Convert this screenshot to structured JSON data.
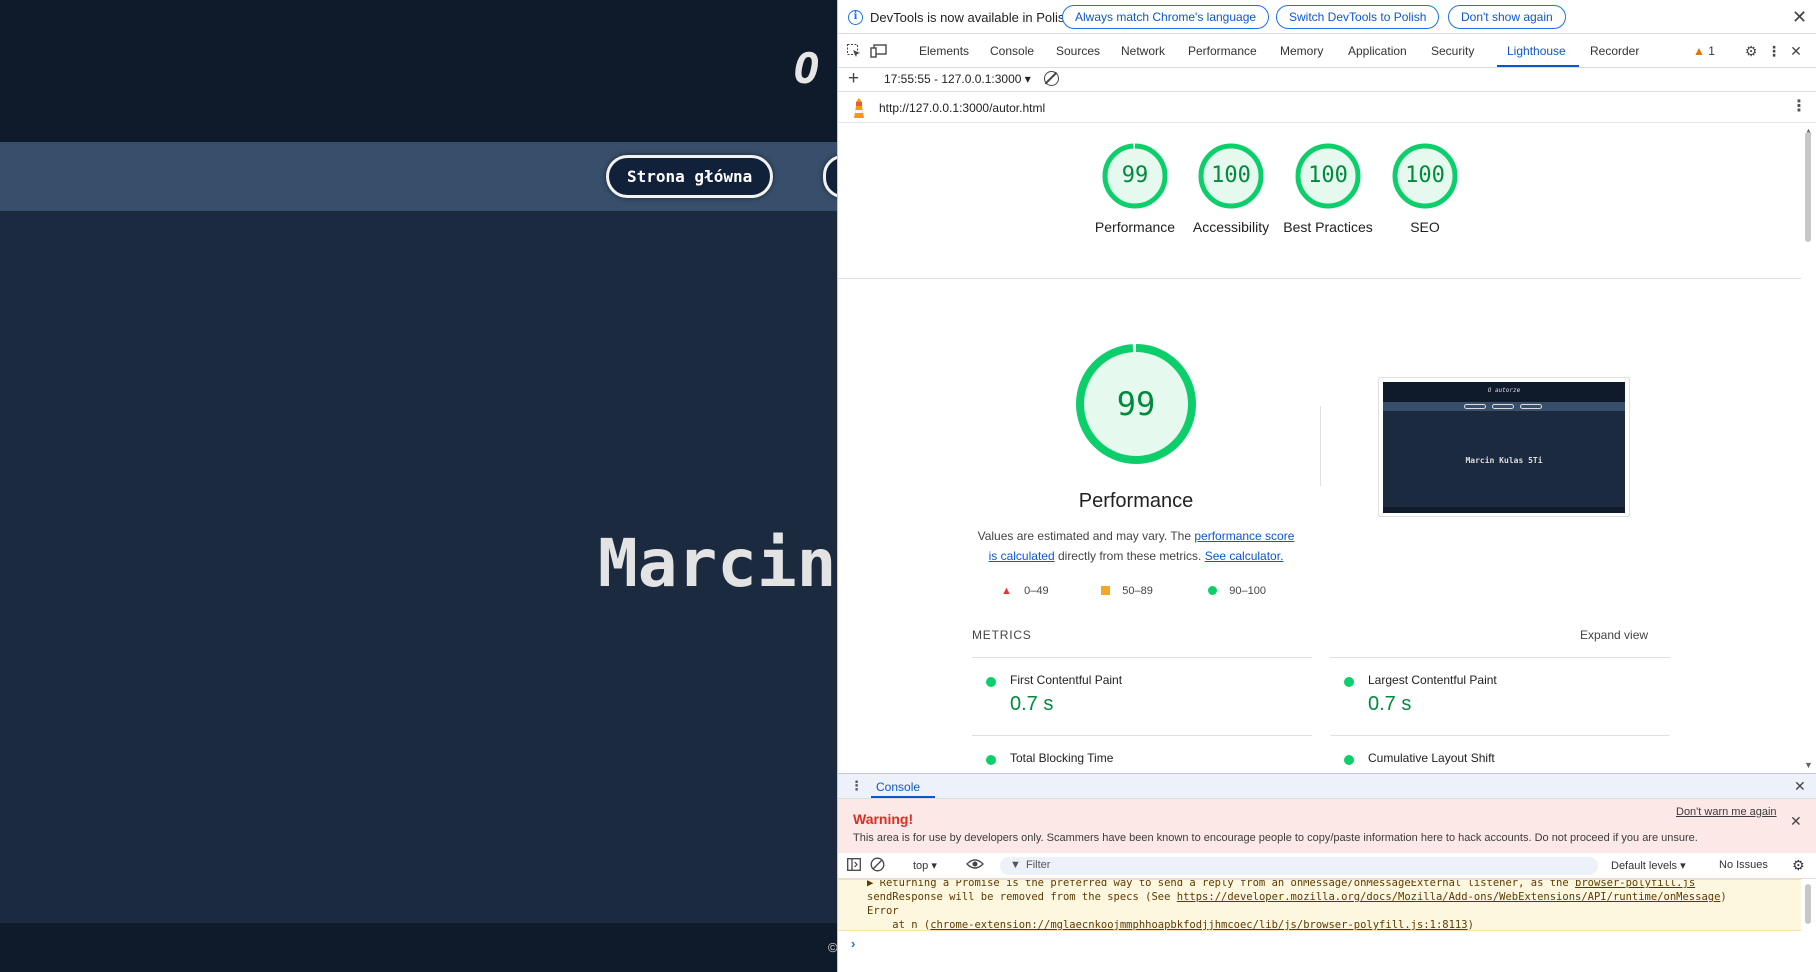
{
  "page": {
    "title": "O",
    "nav_home": "Strona główna",
    "main_text": "Marcin",
    "footer_text": "©"
  },
  "infobar": {
    "message": "DevTools is now available in Polish!",
    "btn_match": "Always match Chrome's language",
    "btn_switch": "Switch DevTools to Polish",
    "btn_dont_show": "Don't show again"
  },
  "tabs": [
    {
      "label": "Elements"
    },
    {
      "label": "Console"
    },
    {
      "label": "Sources"
    },
    {
      "label": "Network"
    },
    {
      "label": "Performance"
    },
    {
      "label": "Memory"
    },
    {
      "label": "Application"
    },
    {
      "label": "Security"
    },
    {
      "label": "Lighthouse",
      "active": true
    },
    {
      "label": "Recorder"
    }
  ],
  "issues_count": "1",
  "lighthouse": {
    "report_select": "17:55:55 - 127.0.0.1:3000",
    "url": "http://127.0.0.1:3000/autor.html",
    "scores": [
      {
        "value": "99",
        "label": "Performance",
        "score": 0.99
      },
      {
        "value": "100",
        "label": "Accessibility",
        "score": 1.0
      },
      {
        "value": "100",
        "label": "Best Practices",
        "score": 1.0
      },
      {
        "value": "100",
        "label": "SEO",
        "score": 1.0
      }
    ],
    "main_score": {
      "value": "99",
      "label": "Performance",
      "score": 0.99
    },
    "desc_before": "Values are estimated and may vary. The ",
    "desc_link1": "performance score is calculated",
    "desc_middle": " directly from these metrics. ",
    "desc_link2": "See calculator.",
    "legend": {
      "red": "0–49",
      "orange": "50–89",
      "green": "90–100"
    },
    "thumbnail": {
      "title": "O autorze",
      "text": "Marcin Kulas 5Ti"
    },
    "metrics_label": "METRICS",
    "expand_view": "Expand view",
    "metrics": [
      {
        "name": "First Contentful Paint",
        "value": "0.7 s"
      },
      {
        "name": "Largest Contentful Paint",
        "value": "0.7 s"
      },
      {
        "name": "Total Blocking Time",
        "value": ""
      },
      {
        "name": "Cumulative Layout Shift",
        "value": ""
      }
    ]
  },
  "drawer": {
    "tab": "Console",
    "warning_title": "Warning!",
    "warning_text": "This area is for use by developers only. Scammers have been known to encourage people to copy/paste information here to hack accounts. Do not proceed if you are unsure.",
    "dont_warn": "Don't warn me again",
    "context": "top",
    "filter_placeholder": "Filter",
    "levels": "Default levels",
    "no_issues": "No Issues",
    "msg_line1": "▶ Returning a Promise is the preferred way to send a reply from an onMessage/onMessageExternal listener, as the",
    "msg_link1": "browser-polyfill.js",
    "msg_line2": "sendResponse will be removed from the specs (See ",
    "msg_link2": "https://developer.mozilla.org/docs/Mozilla/Add-ons/WebExtensions/API/runtime/onMessage",
    "msg_line2_end": ")",
    "msg_line3": "Error",
    "msg_line4_pre": "    at n (",
    "msg_link4": "chrome-extension://mglaecnkoojmmphhoapbkfodjjhmcoec/lib/js/browser-polyfill.js:1:8113",
    "msg_line4_end": ")"
  },
  "colors": {
    "pass_green": "#0cce6b",
    "pass_text": "#008a3d",
    "accent_blue": "#0b57d0",
    "warning_red": "#d93025"
  }
}
